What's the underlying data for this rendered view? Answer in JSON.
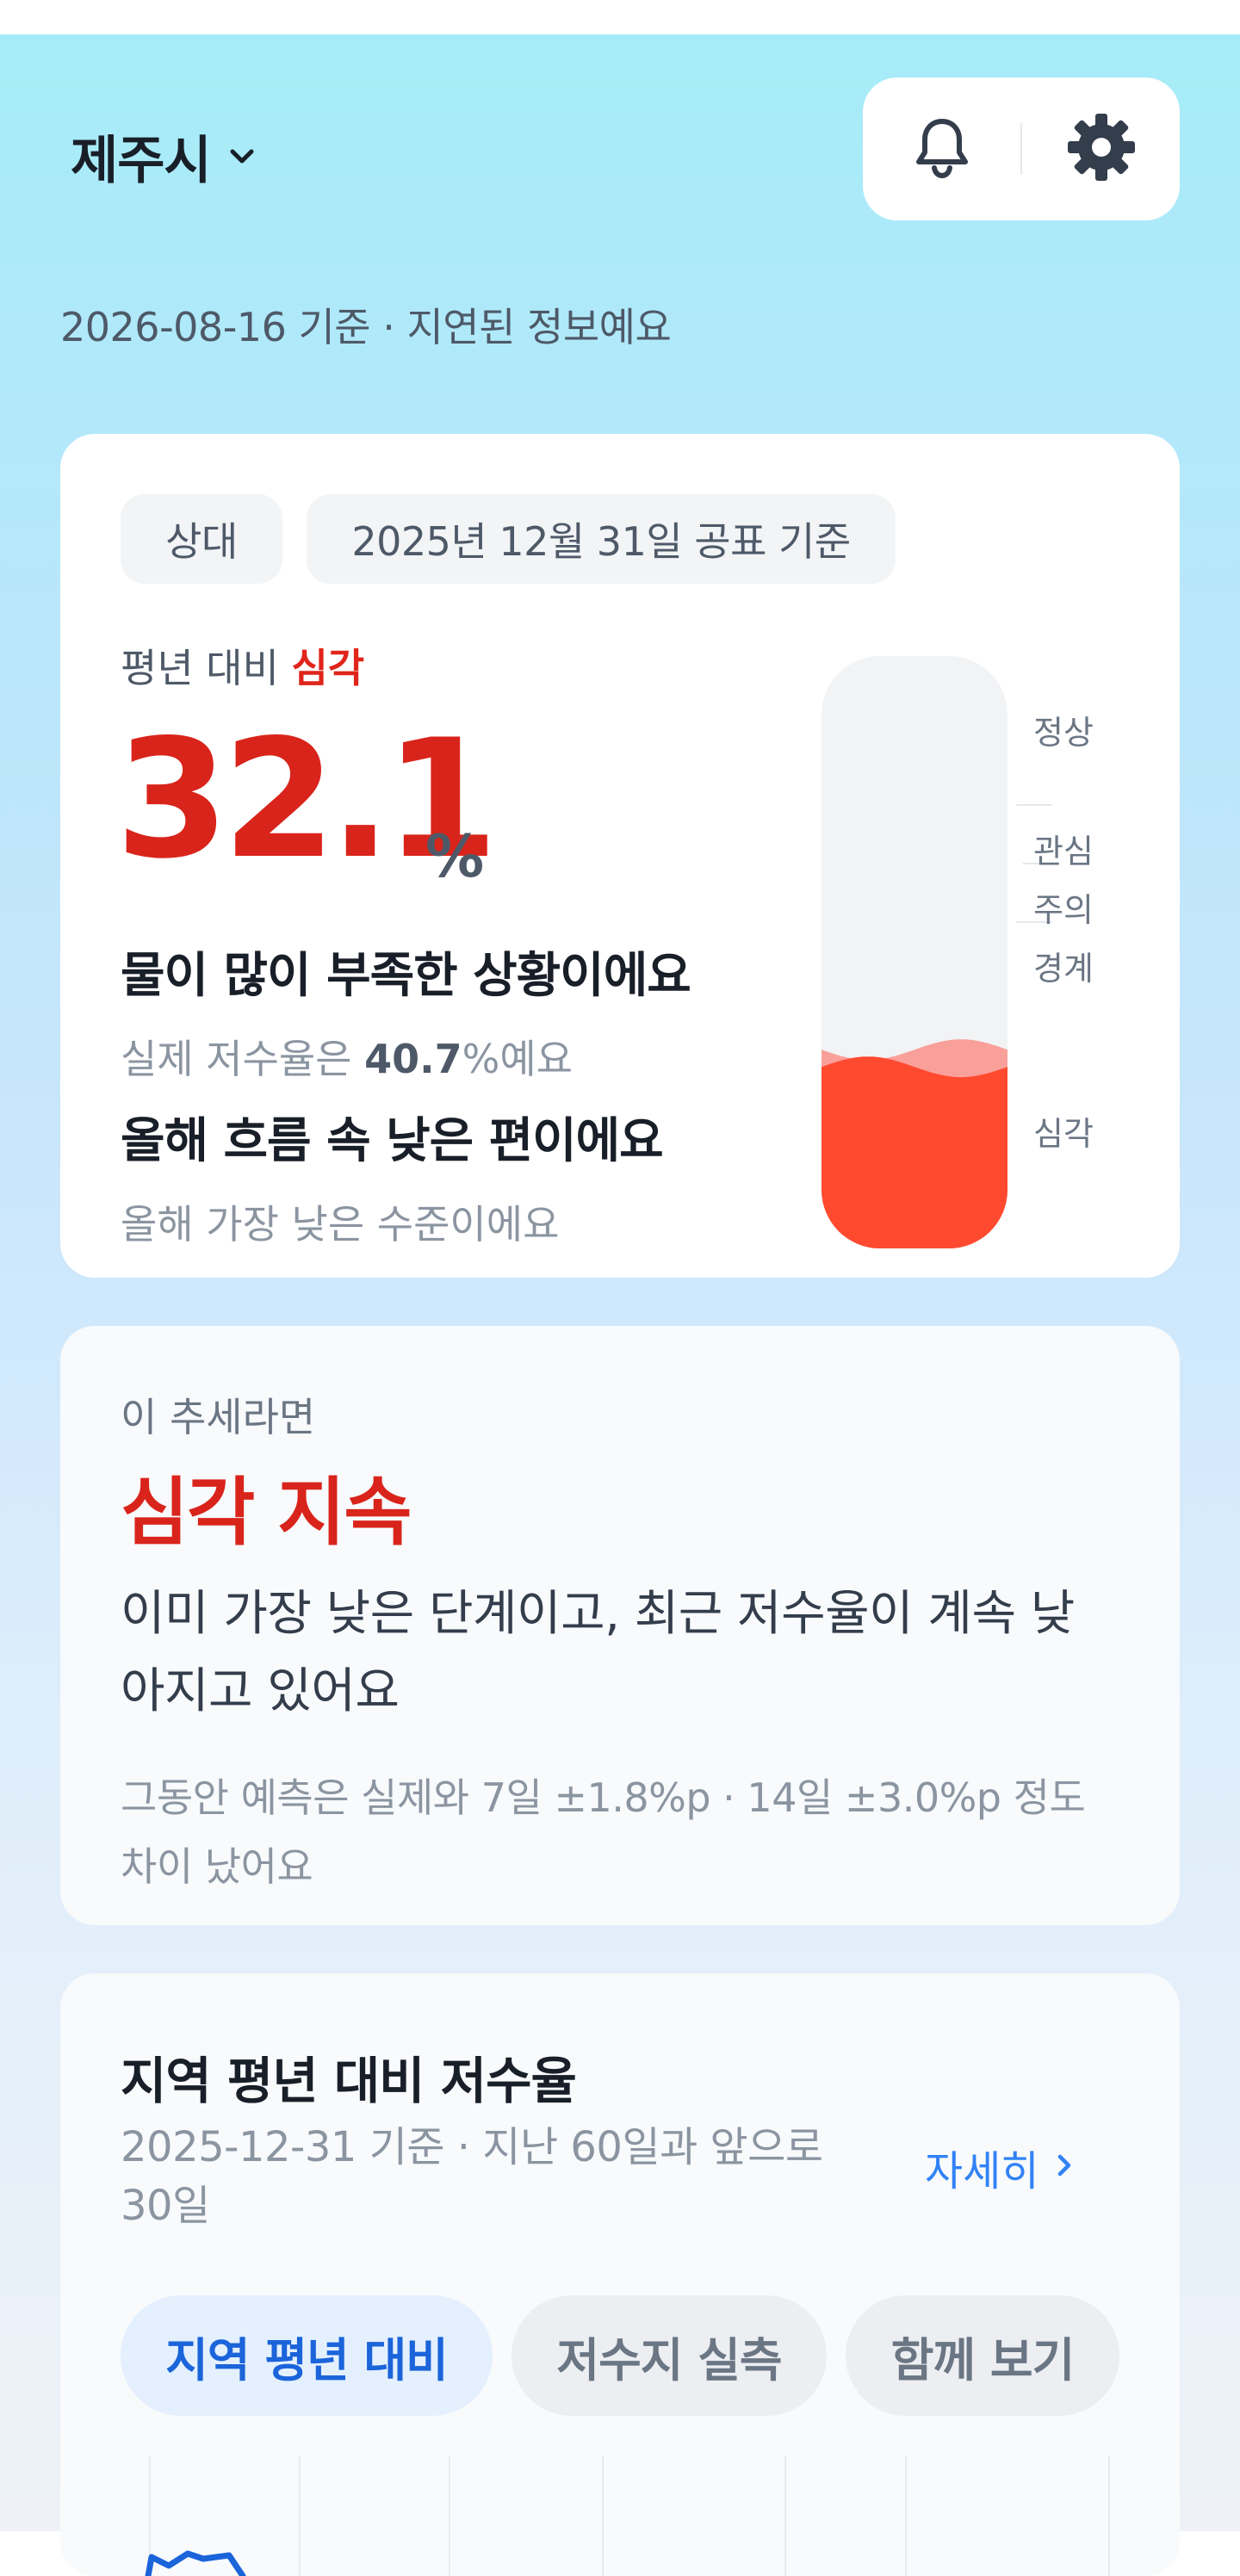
{
  "header": {
    "region": "제주시",
    "status_line": "2026-08-16 기준 · 지연된 정보예요"
  },
  "level_card": {
    "chip_mode": "상대",
    "chip_date": "2025년 12월 31일 공표 기준",
    "level_prefix": "평년 대비",
    "level": "심각",
    "percent": "32.1",
    "unit": "%",
    "message_1": "물이 많이 부족한 상황이에요",
    "actual_prefix": "실제 저수율은 ",
    "actual_value": "40.7",
    "actual_suffix": "%예요",
    "message_2": "올해 흐름 속 낮은 편이에요",
    "sub_2": "올해 가장 낮은 수준이에요",
    "gauge": {
      "fill_fraction": 0.321,
      "labels": [
        "정상",
        "관심",
        "주의",
        "경계",
        "심각"
      ],
      "fill_color": "#ff4a2f",
      "wave_color": "#f9a09a"
    }
  },
  "forecast_card": {
    "kicker": "이 추세라면",
    "title": "심각 지속",
    "body": "이미 가장 낮은 단계이고, 최근 저수율이 계속 낮아지고 있어요",
    "note": "그동안 예측은 실제와 7일 ±1.8%p · 14일 ±3.0%p 정도 차이 났어요"
  },
  "trend_card": {
    "title": "지역 평년 대비 저수율",
    "subtitle": "2025-12-31 기준 · 지난 60일과 앞으로 30일",
    "detail_link": "자세히",
    "tabs": [
      "지역 평년 대비",
      "저수지 실측",
      "함께 보기"
    ],
    "active_tab": 0
  },
  "colors": {
    "accent_red": "#d9241b",
    "link_blue": "#3182f6",
    "series_blue": "#1b64da"
  }
}
